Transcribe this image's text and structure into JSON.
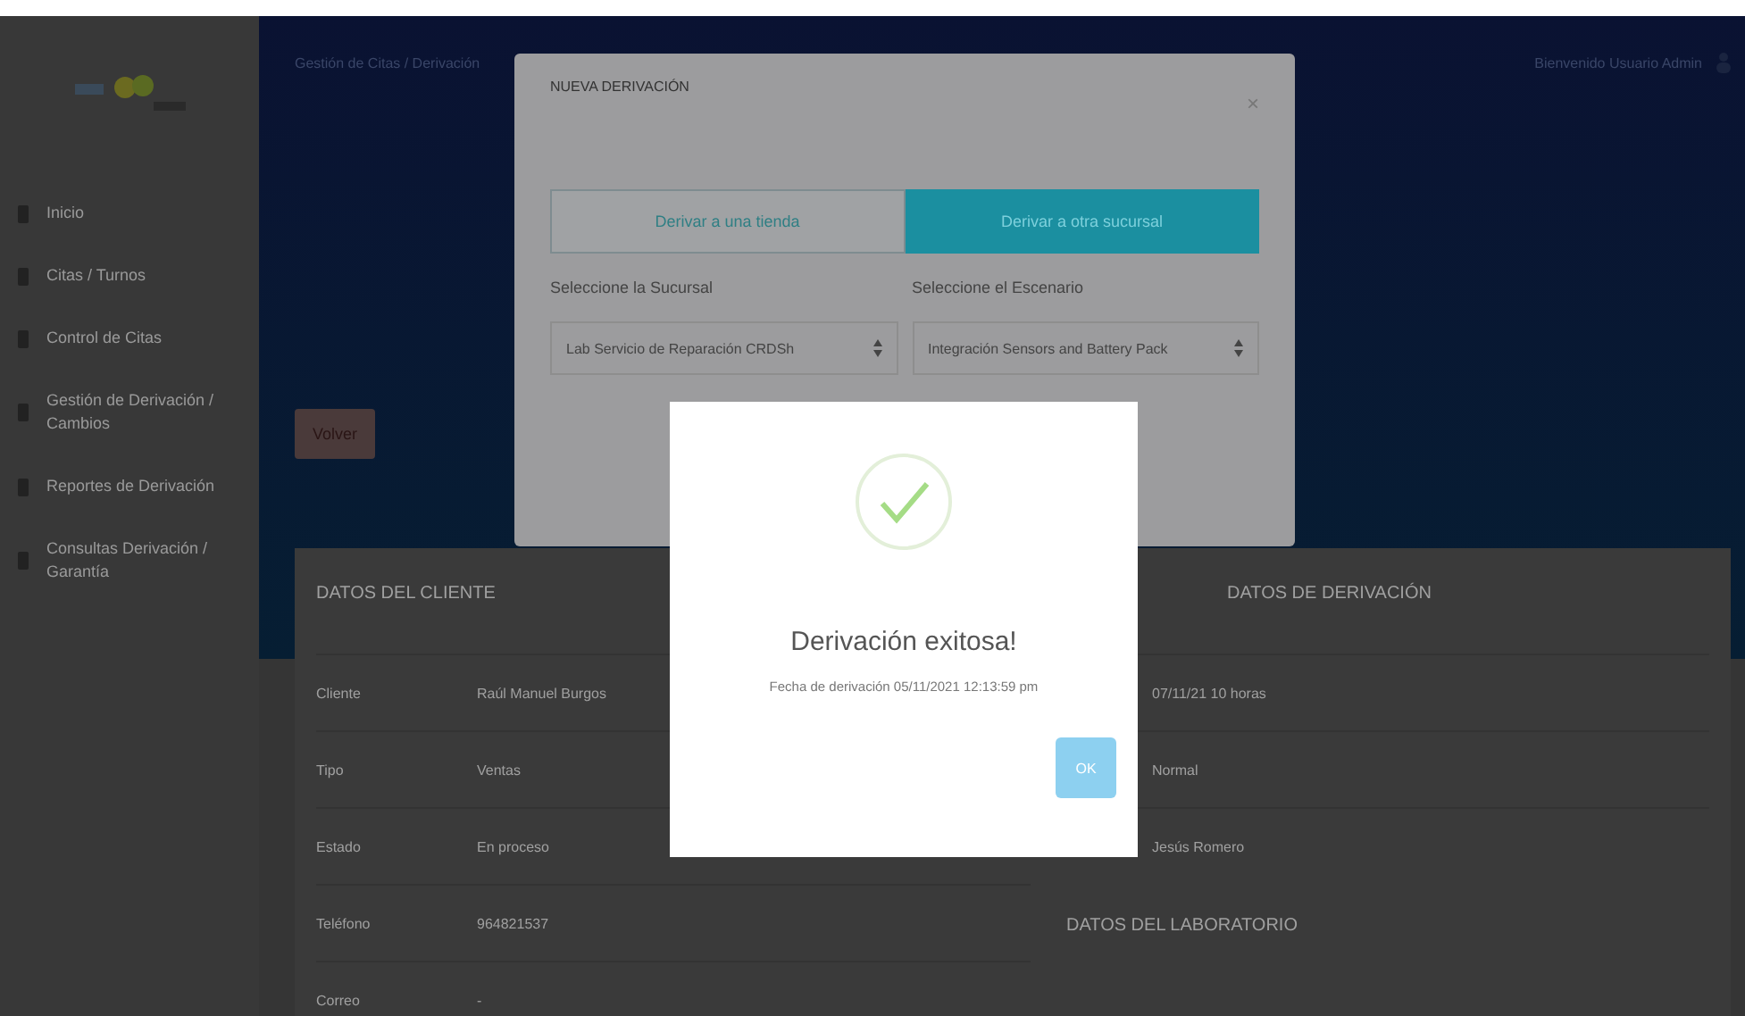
{
  "sidebar": {
    "items": [
      {
        "label": "Inicio",
        "selected": false
      },
      {
        "label": "Citas / Turnos",
        "selected": false
      },
      {
        "label": "Control de Citas",
        "selected": false
      },
      {
        "label": "Gestión de Derivación / Cambios",
        "selected": false
      },
      {
        "label": "Reportes de Derivación",
        "selected": false
      },
      {
        "label": "Consultas Derivación / Garantía",
        "selected": false
      }
    ]
  },
  "header": {
    "breadcrumb": "Gestión de Citas / Derivación",
    "user": "Bienvenido Usuario Admin"
  },
  "back_button": "Volver",
  "details": {
    "left_title": "DATOS DEL CLIENTE",
    "rows": [
      {
        "label": "Cliente",
        "value": "Raúl Manuel Burgos"
      },
      {
        "label": "Tipo",
        "value": "Ventas"
      },
      {
        "label": "Estado",
        "value": "En proceso"
      },
      {
        "label": "Teléfono",
        "value": "964821537"
      },
      {
        "label": "Correo",
        "value": "-"
      }
    ],
    "right_title": "DATOS DE DERIVACIÓN",
    "right_values": [
      "07/11/21 10 horas",
      "Normal",
      "Jesús Romero"
    ],
    "bottom_title": "DATOS DEL LABORATORIO"
  },
  "derive_modal": {
    "title": "NUEVA DERIVACIÓN",
    "close": "×",
    "tabs": [
      {
        "label": "Derivar a una tienda",
        "selected": false
      },
      {
        "label": "Derivar a otra sucursal",
        "selected": true
      }
    ],
    "fields": [
      {
        "label": "Seleccione la Sucursal",
        "value": "Lab Servicio de Reparación CRDSh"
      },
      {
        "label": "Seleccione el Escenario",
        "value": "Integración Sensors and Battery Pack"
      }
    ]
  },
  "success_dialog": {
    "title": "Derivación exitosa!",
    "message": "Fecha de derivación 05/11/2021 12:13:59 pm",
    "button": "OK"
  }
}
